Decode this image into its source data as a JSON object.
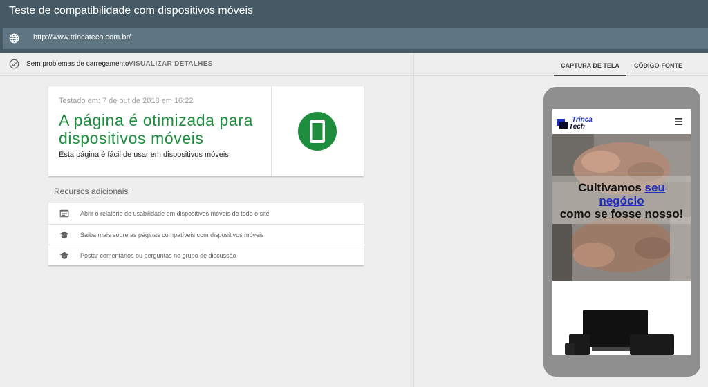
{
  "app": {
    "title": "Teste de compatibilidade com dispositivos móveis"
  },
  "urlbar": {
    "url": "http://www.trincatech.com.br/",
    "icon": "globe-icon"
  },
  "status": {
    "text": "Sem problemas de carregamento",
    "details_link": "VISUALIZAR DETALHES",
    "icon": "check-circle-icon"
  },
  "result": {
    "tested_at": "Testado em: 7 de out de 2018 em 16:22",
    "headline_line1": "A página é otimizada para",
    "headline_line2": "dispositivos móveis",
    "subtext": "Esta página é fácil de usar em dispositivos móveis",
    "icon": "smartphone-icon",
    "accent_color": "#1e8e3e"
  },
  "resources": {
    "title": "Recursos adicionais",
    "items": [
      {
        "label": "Abrir o relatório de usabilidade em dispositivos móveis de todo o site",
        "icon": "web-report-icon"
      },
      {
        "label": "Saiba mais sobre as páginas compatíveis com dispositivos móveis",
        "icon": "school-cap-icon"
      },
      {
        "label": "Postar comentários ou perguntas no grupo de discussão",
        "icon": "school-cap-icon"
      }
    ]
  },
  "tabs": [
    {
      "label": "CAPTURA DE TELA",
      "active": true
    },
    {
      "label": "CÓDIGO-FONTE",
      "active": false
    }
  ],
  "preview": {
    "logo_line1": "Trinca",
    "logo_line2": "Tech",
    "hero_line1": "Cultivamos",
    "hero_hl1": "seu",
    "hero_hl2": "negócio",
    "hero_line3": "como se fosse nosso!",
    "brand_blue": "#1e2fc0"
  },
  "colors": {
    "header_bg": "#455a64",
    "urlbar_bg": "#5f7682",
    "page_bg": "#eeeeee"
  }
}
